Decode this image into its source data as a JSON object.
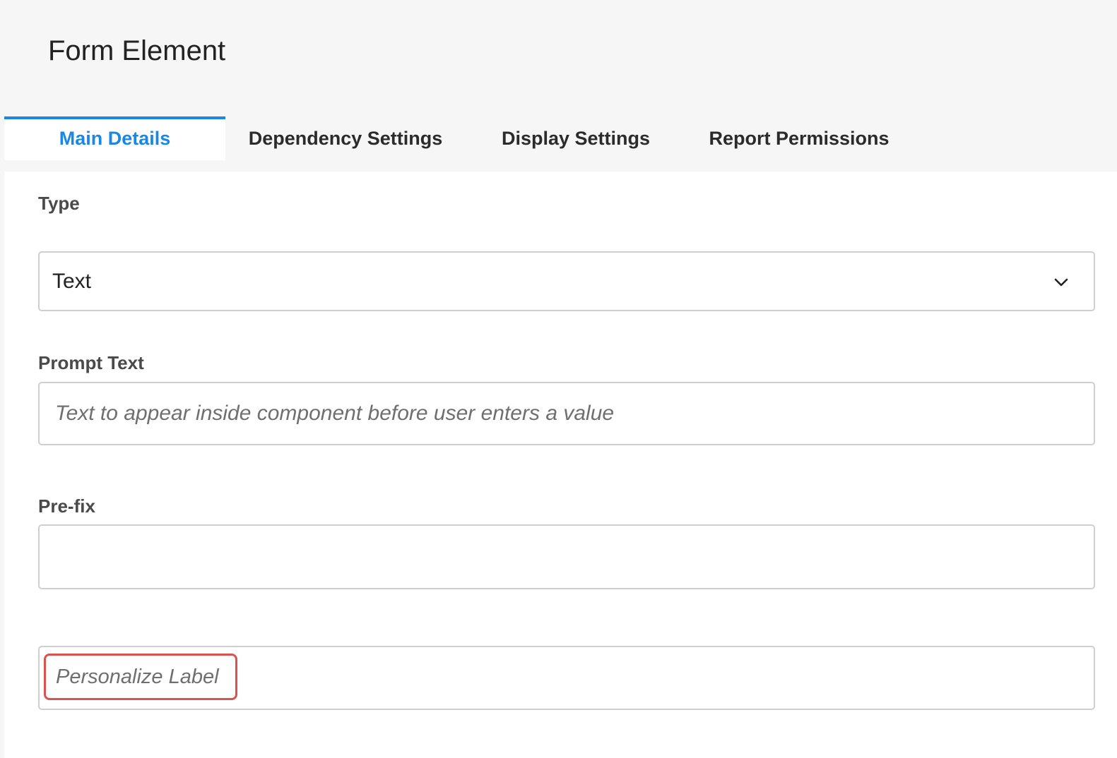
{
  "page": {
    "title": "Form Element"
  },
  "tabs": [
    {
      "label": "Main Details",
      "active": true
    },
    {
      "label": "Dependency Settings",
      "active": false
    },
    {
      "label": "Display Settings",
      "active": false
    },
    {
      "label": "Report Permissions",
      "active": false
    }
  ],
  "form": {
    "type": {
      "label": "Type",
      "value": "Text",
      "icon": "chevron-down-icon"
    },
    "prompt_text": {
      "label": "Prompt Text",
      "placeholder": "Text to appear inside component before user enters a value",
      "value": ""
    },
    "prefix": {
      "label": "Pre-fix",
      "value": ""
    },
    "personalize_label": {
      "placeholder": "Personalize Label",
      "highlight_color": "#d9534f"
    }
  },
  "colors": {
    "accent": "#1a87e6",
    "background": "#f6f6f6",
    "panel": "#ffffff",
    "border": "#cfcfcf"
  }
}
